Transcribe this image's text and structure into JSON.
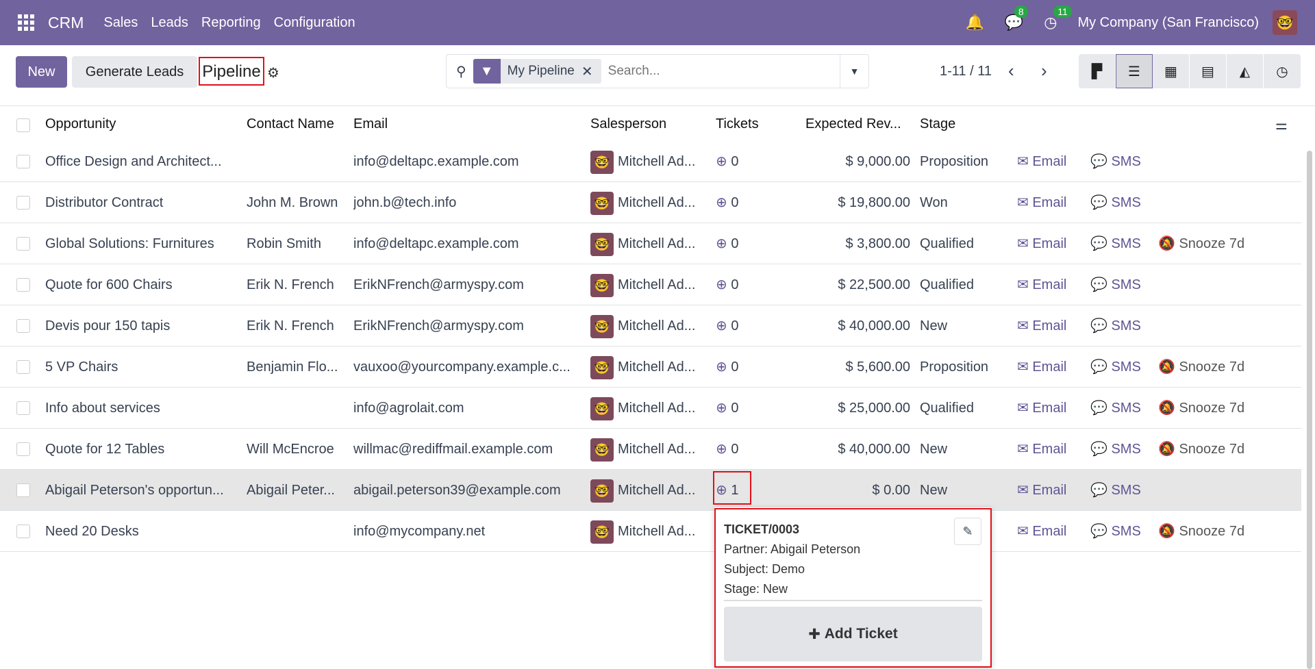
{
  "nav": {
    "brand": "CRM",
    "menus": [
      "Sales",
      "Leads",
      "Reporting",
      "Configuration"
    ],
    "messages_count": "8",
    "activities_count": "11",
    "company": "My Company (San Francisco)"
  },
  "control": {
    "new_label": "New",
    "generate_label": "Generate Leads",
    "title": "Pipeline",
    "facet": "My Pipeline",
    "search_placeholder": "Search...",
    "pager": "1-11 / 11"
  },
  "views": [
    "kanban",
    "list",
    "calendar",
    "pivot",
    "graph",
    "activity"
  ],
  "columns": [
    "Opportunity",
    "Contact Name",
    "Email",
    "Salesperson",
    "Tickets",
    "Expected Rev...",
    "Stage"
  ],
  "rows": [
    {
      "opportunity": "Office Design and Architect...",
      "contact": "",
      "email": "info@deltapc.example.com",
      "salesperson": "Mitchell Ad...",
      "tickets": "0",
      "revenue": "$ 9,000.00",
      "stage": "Proposition",
      "snooze": ""
    },
    {
      "opportunity": "Distributor Contract",
      "contact": "John M. Brown",
      "email": "john.b@tech.info",
      "salesperson": "Mitchell Ad...",
      "tickets": "0",
      "revenue": "$ 19,800.00",
      "stage": "Won",
      "snooze": ""
    },
    {
      "opportunity": "Global Solutions: Furnitures",
      "contact": "Robin Smith",
      "email": "info@deltapc.example.com",
      "salesperson": "Mitchell Ad...",
      "tickets": "0",
      "revenue": "$ 3,800.00",
      "stage": "Qualified",
      "snooze": "Snooze 7d"
    },
    {
      "opportunity": "Quote for 600 Chairs",
      "contact": "Erik N. French",
      "email": "ErikNFrench@armyspy.com",
      "salesperson": "Mitchell Ad...",
      "tickets": "0",
      "revenue": "$ 22,500.00",
      "stage": "Qualified",
      "snooze": ""
    },
    {
      "opportunity": "Devis pour 150 tapis",
      "contact": "Erik N. French",
      "email": "ErikNFrench@armyspy.com",
      "salesperson": "Mitchell Ad...",
      "tickets": "0",
      "revenue": "$ 40,000.00",
      "stage": "New",
      "snooze": ""
    },
    {
      "opportunity": "5 VP Chairs",
      "contact": "Benjamin Flo...",
      "email": "vauxoo@yourcompany.example.c...",
      "salesperson": "Mitchell Ad...",
      "tickets": "0",
      "revenue": "$ 5,600.00",
      "stage": "Proposition",
      "snooze": "Snooze 7d"
    },
    {
      "opportunity": "Info about services",
      "contact": "",
      "email": "info@agrolait.com",
      "salesperson": "Mitchell Ad...",
      "tickets": "0",
      "revenue": "$ 25,000.00",
      "stage": "Qualified",
      "snooze": "Snooze 7d"
    },
    {
      "opportunity": "Quote for 12 Tables",
      "contact": "Will McEncroe",
      "email": "willmac@rediffmail.example.com",
      "salesperson": "Mitchell Ad...",
      "tickets": "0",
      "revenue": "$ 40,000.00",
      "stage": "New",
      "snooze": "Snooze 7d"
    },
    {
      "opportunity": "Abigail Peterson's opportun...",
      "contact": "Abigail Peter...",
      "email": "abigail.peterson39@example.com",
      "salesperson": "Mitchell Ad...",
      "tickets": "1",
      "revenue": "$ 0.00",
      "stage": "New",
      "snooze": ""
    },
    {
      "opportunity": "Need 20 Desks",
      "contact": "",
      "email": "info@mycompany.net",
      "salesperson": "Mitchell Ad...",
      "tickets": "0",
      "revenue": "",
      "stage": "",
      "snooze": "Snooze 7d"
    }
  ],
  "actions": {
    "email": "Email",
    "sms": "SMS"
  },
  "popup": {
    "ticket": "TICKET/0003",
    "partner": "Partner: Abigail Peterson",
    "subject": "Subject: Demo",
    "stage": "Stage: New",
    "add_label": "Add Ticket"
  },
  "colors": {
    "brand": "#71639e",
    "highlight": "#e0101a",
    "badge": "#28a745"
  }
}
